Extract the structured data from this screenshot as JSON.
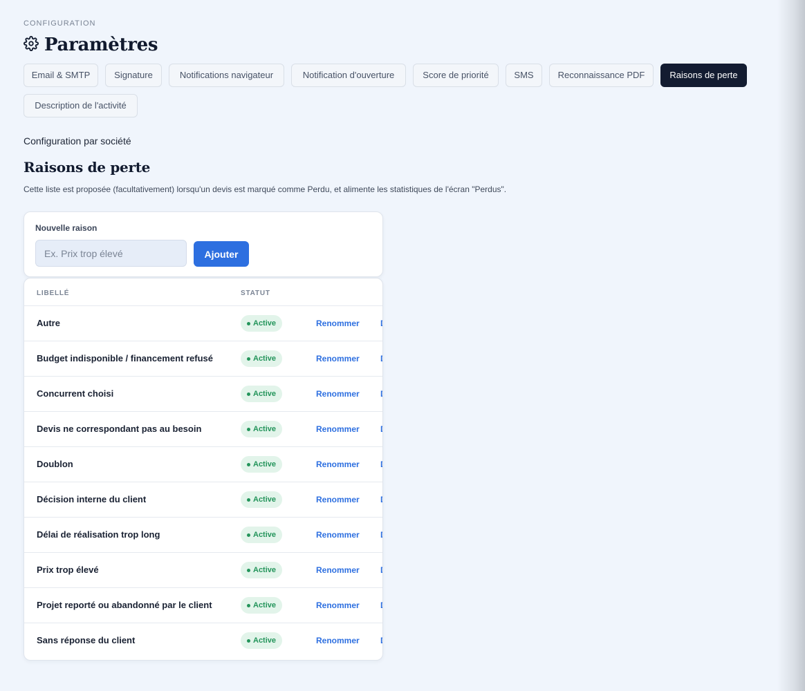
{
  "header": {
    "eyebrow": "CONFIGURATION",
    "title": "Paramètres",
    "icon": "gear-icon"
  },
  "tabs": [
    {
      "label": "Email & SMTP",
      "active": false
    },
    {
      "label": "Signature",
      "active": false
    },
    {
      "label": "Notifications navigateur",
      "active": false
    },
    {
      "label": "Notification d'ouverture",
      "active": false
    },
    {
      "label": "Score de priorité",
      "active": false
    },
    {
      "label": "SMS",
      "active": false
    },
    {
      "label": "Reconnaissance PDF",
      "active": false
    },
    {
      "label": "Raisons de perte",
      "active": true
    },
    {
      "label": "Description de l'activité",
      "active": false
    }
  ],
  "section": {
    "sub_label": "Configuration par société",
    "title": "Raisons de perte",
    "description": "Cette liste est proposée (facultativement) lorsqu'un devis est marqué comme Perdu, et alimente les statistiques de l'écran \"Perdus\"."
  },
  "new_reason": {
    "label": "Nouvelle raison",
    "placeholder": "Ex. Prix trop élevé",
    "value": "",
    "button": "Ajouter"
  },
  "table": {
    "columns": [
      "LIBELLÉ",
      "STATUT"
    ],
    "rename_label": "Renommer",
    "truncated_action": "D",
    "rows": [
      {
        "label": "Autre",
        "status": "Active"
      },
      {
        "label": "Budget indisponible / financement refusé",
        "status": "Active"
      },
      {
        "label": "Concurrent choisi",
        "status": "Active"
      },
      {
        "label": "Devis ne correspondant pas au besoin",
        "status": "Active"
      },
      {
        "label": "Doublon",
        "status": "Active"
      },
      {
        "label": "Décision interne du client",
        "status": "Active"
      },
      {
        "label": "Délai de réalisation trop long",
        "status": "Active"
      },
      {
        "label": "Prix trop élevé",
        "status": "Active"
      },
      {
        "label": "Projet reporté ou abandonné par le client",
        "status": "Active"
      },
      {
        "label": "Sans réponse du client",
        "status": "Active"
      }
    ]
  },
  "colors": {
    "accent": "#2d6fe0",
    "active_tab_bg": "#131c31",
    "badge_bg": "#e2f4ea",
    "badge_text": "#23945a",
    "page_bg": "#f0f5fc"
  }
}
